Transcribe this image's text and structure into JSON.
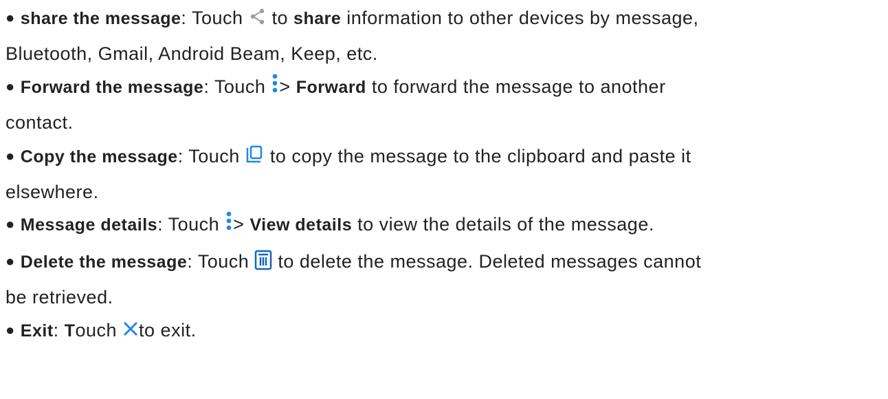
{
  "colors": {
    "text": "#222222",
    "icon_gray": "#9e9e9e",
    "icon_blue": "#1e88e5",
    "delete_icon": "#1565c0"
  },
  "bullet": "●",
  "items": [
    {
      "term": "share the message",
      "colon": ":",
      "pre": " Touch ",
      "icon": "share-icon",
      "mid_pre": " to ",
      "bold": "share",
      "line1_rest": " information to other devices by message,",
      "line2": "Bluetooth, Gmail, Android Beam, Keep, etc."
    },
    {
      "term": "Forward the message",
      "colon": ":",
      "pre": " Touch ",
      "icon": "more-vert-icon",
      "gt": "> ",
      "bold": "Forward",
      "line1_rest": " to forward the message to another",
      "line2": "contact."
    },
    {
      "term": "Copy the message",
      "colon": ":",
      "pre": " Touch ",
      "icon": "copy-icon",
      "line1_rest": " to copy the message to the clipboard and paste it",
      "line2": "elsewhere."
    },
    {
      "term": "Message details",
      "colon": ":",
      "pre": " Touch ",
      "icon": "more-vert-icon",
      "gt": "> ",
      "bold": "View details",
      "line1_rest": " to view the details of the message."
    },
    {
      "term": "Delete the message",
      "colon": ":",
      "pre": " Touch ",
      "icon": "delete-icon",
      "line1_rest": " to delete the message. Deleted messages cannot",
      "line2": "be retrieved."
    },
    {
      "term": "Exit",
      "colon": ":",
      "touch_bold": "T",
      "touch_rest": "ouch ",
      "icon": "close-icon",
      "line1_rest": "to exit."
    }
  ]
}
